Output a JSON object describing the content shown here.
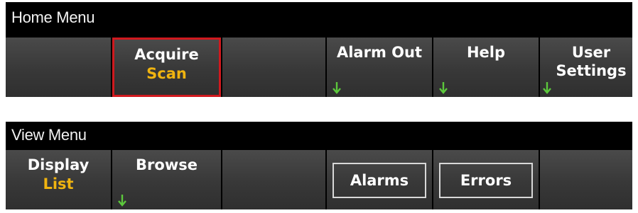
{
  "home_menu": {
    "title": "Home Menu",
    "softkeys": [
      {
        "label": "",
        "value": ""
      },
      {
        "label": "Acquire",
        "value": "Scan",
        "selected": true
      },
      {
        "label": "",
        "value": ""
      },
      {
        "label": "Alarm Out",
        "value": "",
        "submenu_arrow": true
      },
      {
        "label": "Help",
        "value": "",
        "submenu_arrow": true
      },
      {
        "label": "User",
        "label2": "Settings",
        "submenu_arrow": true
      }
    ]
  },
  "view_menu": {
    "title": "View Menu",
    "softkeys": [
      {
        "label": "Display",
        "value": "List"
      },
      {
        "label": "Browse",
        "value": "",
        "submenu_arrow": true
      },
      {
        "label": "",
        "value": ""
      },
      {
        "label": "Alarms",
        "framed": true
      },
      {
        "label": "Errors",
        "framed": true
      },
      {
        "label": "",
        "value": ""
      }
    ]
  },
  "colors": {
    "background": "#000000",
    "softkey_fill": "#3a3a3a",
    "value_text": "#f0b410",
    "selection_border": "#d0191e",
    "arrow": "#5cc83c"
  },
  "icons": {
    "submenu": "down-arrow-icon"
  }
}
